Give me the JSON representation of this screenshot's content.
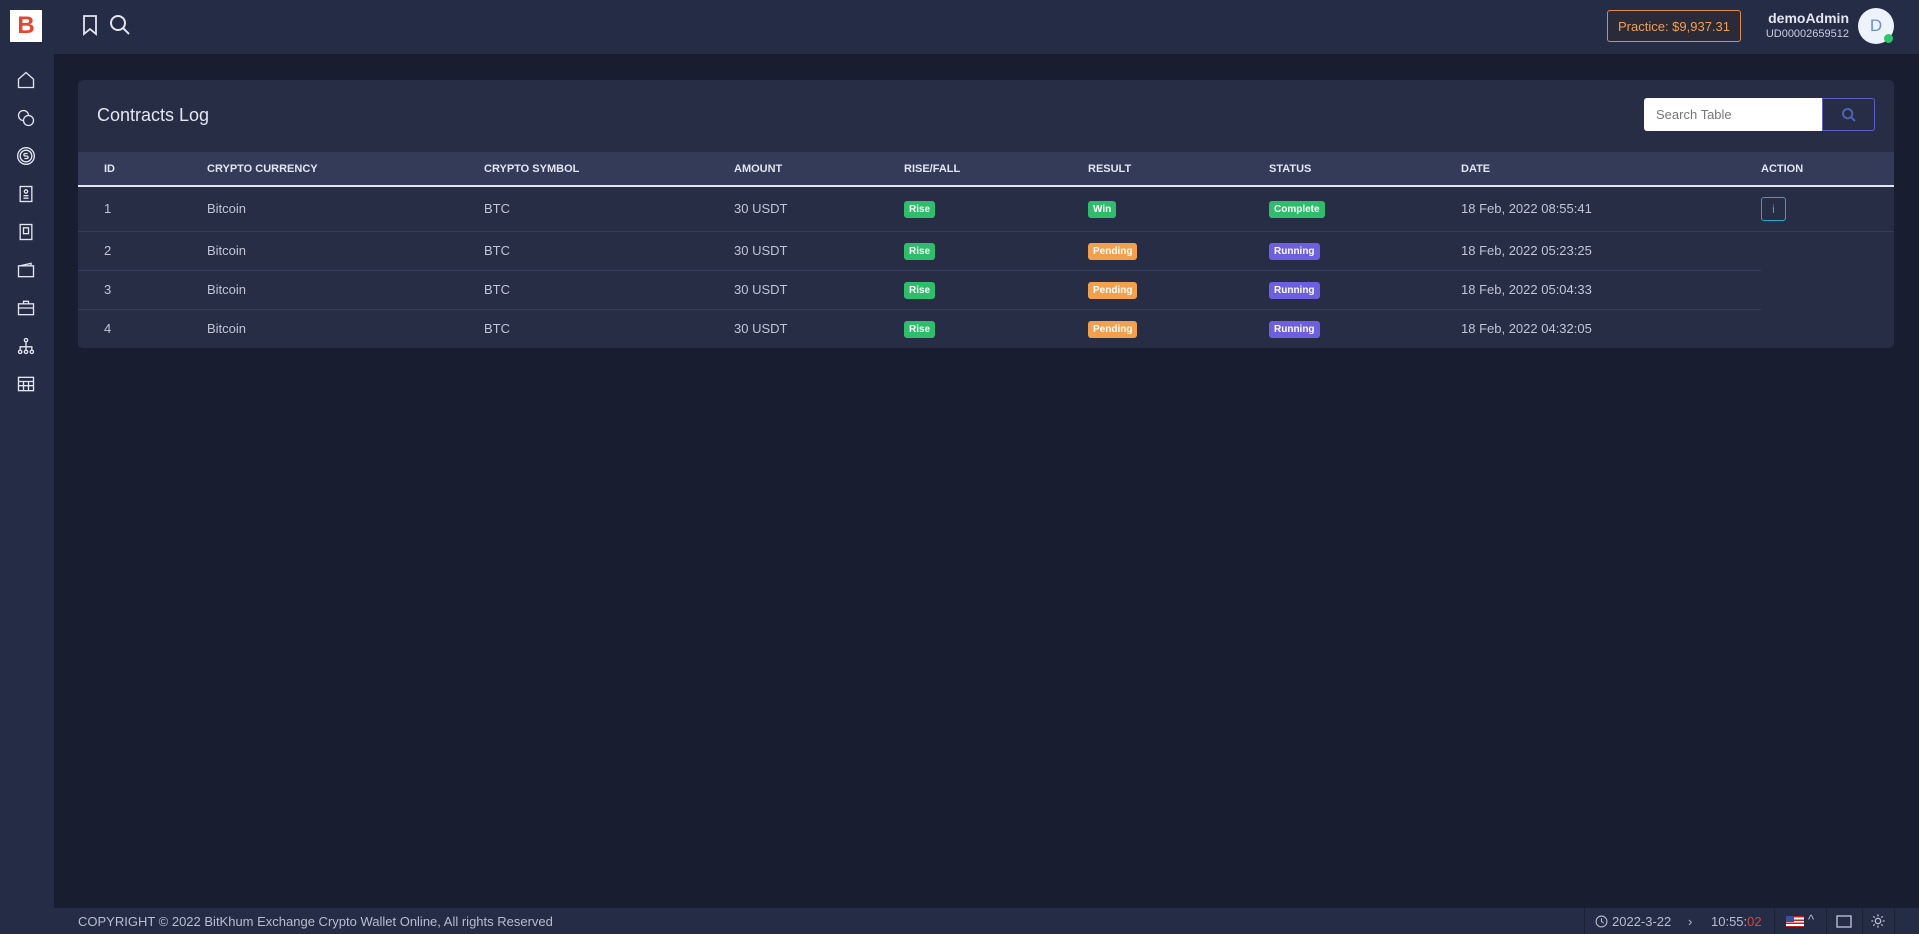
{
  "app": {
    "logo_letter": "B"
  },
  "sidebar": {
    "items": [
      {
        "icon": "home-icon"
      },
      {
        "icon": "coins-icon"
      },
      {
        "icon": "dollar-circle-icon"
      },
      {
        "icon": "contacts-book-icon"
      },
      {
        "icon": "notebook-icon"
      },
      {
        "icon": "wallet-icon"
      },
      {
        "icon": "briefcase-icon"
      },
      {
        "icon": "network-icon"
      },
      {
        "icon": "spreadsheet-icon"
      }
    ]
  },
  "header": {
    "practice_label": "Practice: $9,937.31",
    "username": "demoAdmin",
    "user_id": "UD00002659512",
    "avatar_letter": "D"
  },
  "main": {
    "title": "Contracts Log",
    "search_placeholder": "Search Table",
    "columns": [
      "ID",
      "CRYPTO CURRENCY",
      "CRYPTO SYMBOL",
      "AMOUNT",
      "RISE/FALL",
      "RESULT",
      "STATUS",
      "DATE",
      "ACTION"
    ],
    "rows": [
      {
        "id": "1",
        "currency": "Bitcoin",
        "symbol": "BTC",
        "amount": "30 USDT",
        "rise_fall": "Rise",
        "result": "Win",
        "status": "Complete",
        "date": "18 Feb, 2022 08:55:41",
        "action": "i"
      },
      {
        "id": "2",
        "currency": "Bitcoin",
        "symbol": "BTC",
        "amount": "30 USDT",
        "rise_fall": "Rise",
        "result": "Pending",
        "status": "Running",
        "date": "18 Feb, 2022 05:23:25"
      },
      {
        "id": "3",
        "currency": "Bitcoin",
        "symbol": "BTC",
        "amount": "30 USDT",
        "rise_fall": "Rise",
        "result": "Pending",
        "status": "Running",
        "date": "18 Feb, 2022 05:04:33"
      },
      {
        "id": "4",
        "currency": "Bitcoin",
        "symbol": "BTC",
        "amount": "30 USDT",
        "rise_fall": "Rise",
        "result": "Pending",
        "status": "Running",
        "date": "18 Feb, 2022 04:32:05"
      }
    ]
  },
  "colors": {
    "win": "#2ebd6b",
    "complete": "#2ebd6b",
    "rise": "#2ebd6b",
    "pending": "#f2a04c",
    "running": "#6c5fe0",
    "accent": "#e08b45"
  },
  "footer": {
    "copyright": "COPYRIGHT © 2022 BitKhum Exchange Crypto Wallet Online, All rights Reserved",
    "date": "2022-3-22",
    "time_hm": "10:55:",
    "time_s": "02"
  }
}
